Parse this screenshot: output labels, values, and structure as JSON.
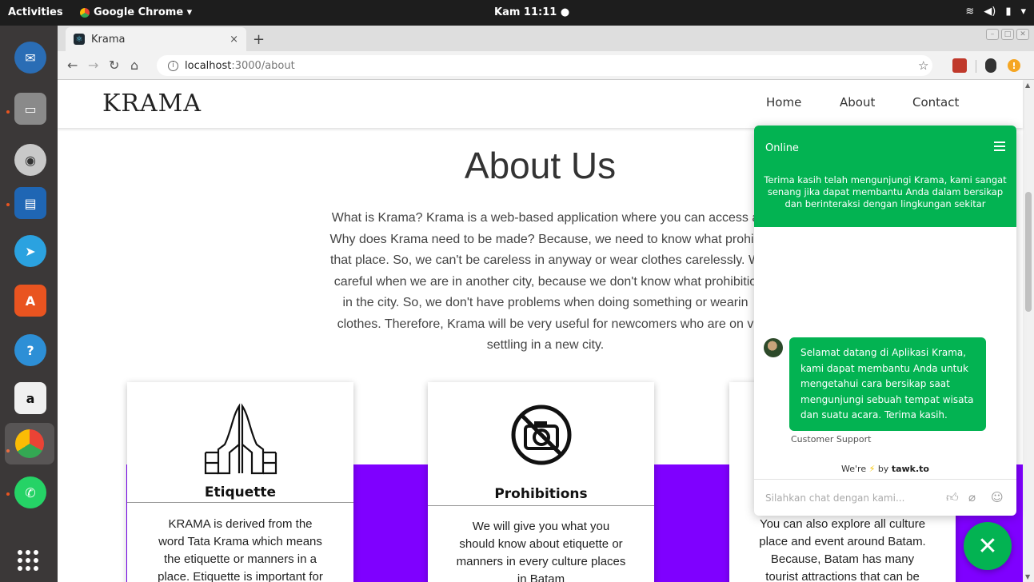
{
  "os": {
    "activities": "Activities",
    "app_menu": "Google Chrome ▾",
    "clock": "Kam 11:11 ●",
    "tray": [
      "wifi-icon",
      "volume-icon",
      "battery-icon",
      "power-menu-icon"
    ],
    "launcher": [
      "thunderbird-icon",
      "files-icon",
      "rhythmbox-icon",
      "writer-icon",
      "telegram-icon",
      "software-center-icon",
      "help-icon",
      "amazon-icon",
      "chrome-icon",
      "whatsapp-icon",
      "show-apps-icon"
    ]
  },
  "browser": {
    "tab_title": "Krama",
    "tab_close": "×",
    "new_tab": "+",
    "url_host": "localhost",
    "url_rest": ":3000/about"
  },
  "site": {
    "logo": "KRAMA",
    "nav": [
      "Home",
      "About",
      "Contact"
    ],
    "about_title": "About Us",
    "about_lines": [
      "What is Krama? Krama is a web-based application where you can access a",
      "Why does Krama need to be made? Because, we need to know what prohib",
      "that place. So, we can't be careless in anyway or wear clothes carelessly. W",
      "careful when we are in another city, because we don't know what prohibitio",
      "in the city. So, we don't have problems when doing something or wearin",
      "clothes. Therefore, Krama will be very useful for newcomers who are on v",
      "settling in a new city."
    ],
    "cards": [
      {
        "icon": "praying-hands-icon",
        "title": "Etiquette",
        "text": [
          "KRAMA is derived from the",
          "word Tata Krama which means",
          "the etiquette or manners in a",
          "place. Etiquette is important for"
        ]
      },
      {
        "icon": "no-camera-icon",
        "title": "Prohibitions",
        "text": [
          "We will give you what you",
          "should know about etiquette or",
          "manners in every culture places",
          "in Batam"
        ]
      },
      {
        "icon": "",
        "title": "",
        "text": [
          "You can also explore all culture",
          "place and event around Batam.",
          "Because, Batam has many",
          "tourist attractions that can be"
        ]
      }
    ]
  },
  "chat": {
    "status": "Online",
    "welcome": "Terima kasih telah mengunjungi Krama, kami sangat senang jika dapat membantu Anda dalam bersikap dan berinteraksi dengan lingkungan sekitar",
    "message_lines": [
      "Selamat datang di Aplikasi Krama,",
      "kami dapat membantu Anda untuk",
      "mengetahui cara bersikap saat",
      "mengunjungi sebuah tempat wisata",
      "dan suatu acara. Terima kasih."
    ],
    "sender": "Customer Support",
    "powered_pre": "We're",
    "powered_by": "by",
    "powered_brand": "tawk.to",
    "input_placeholder": "Silahkan chat dengan kami...",
    "close_fab": "✕"
  },
  "colors": {
    "accent_purple": "#7f00ff",
    "chat_green": "#03b352"
  }
}
